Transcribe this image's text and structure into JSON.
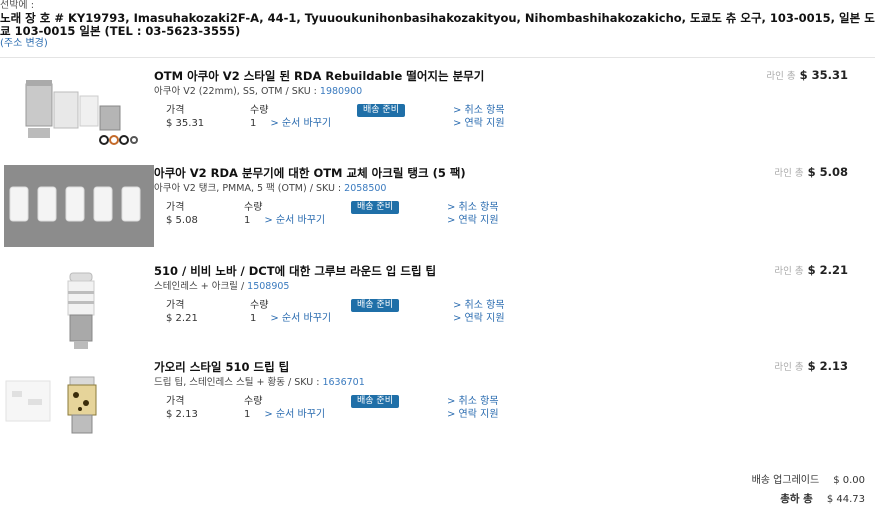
{
  "shipping": {
    "caption": "선박에 :",
    "address": "노래 장 호 # KY19793, Imasuhakozaki2F-A, 44-1, Tyuuoukunihonbasihakozakityou, Nihombashihakozakicho, 도쿄도 츄 오구, 103-0015, 일본 도쿄 103-0015 일본 (TEL : 03-5623-3555)",
    "change_label": "(주소 변경)"
  },
  "labels": {
    "price": "가격",
    "qty": "수량",
    "reorder": "> 순서 바꾸기",
    "ship_ready": "배송 준비",
    "cancel": "> 취소 항목",
    "contact": "> 연락 지원",
    "line_total": "라인 총",
    "sku_prefix": "SKU :"
  },
  "items": [
    {
      "title": "OTM 아쿠아 V2 스타일 된 RDA Rebuildable 떨어지는 분무기",
      "subtitle": "아쿠아 V2 (22mm), SS, OTM /",
      "sku": "1980900",
      "price": "$ 35.31",
      "qty": "1",
      "line_total": "$ 35.31"
    },
    {
      "title": "아쿠아 V2 RDA 분무기에 대한 OTM 교체 아크릴 탱크 (5 팩)",
      "subtitle": "아쿠아 V2 탱크, PMMA, 5 팩 (OTM) /",
      "sku": "2058500",
      "price": "$ 5.08",
      "qty": "1",
      "line_total": "$ 5.08"
    },
    {
      "title": "510 / 비비 노바 / DCT에 대한 그루브 라운드 입 드립 팁",
      "subtitle": "스테인레스 + 아크릴 /",
      "sku": "1508905",
      "price": "$ 2.21",
      "qty": "1",
      "line_total": "$ 2.21"
    },
    {
      "title": "가오리 스타일 510 드립 팁",
      "subtitle": "드립 팁, 스테인레스 스틸 + 황동 /",
      "sku": "1636701",
      "price": "$ 2.13",
      "qty": "1",
      "line_total": "$ 2.13"
    }
  ],
  "summary": {
    "shipping_label": "배송 업그레이드",
    "shipping_value": "$ 0.00",
    "total_label": "총하 총",
    "total_value": "$ 44.73"
  }
}
